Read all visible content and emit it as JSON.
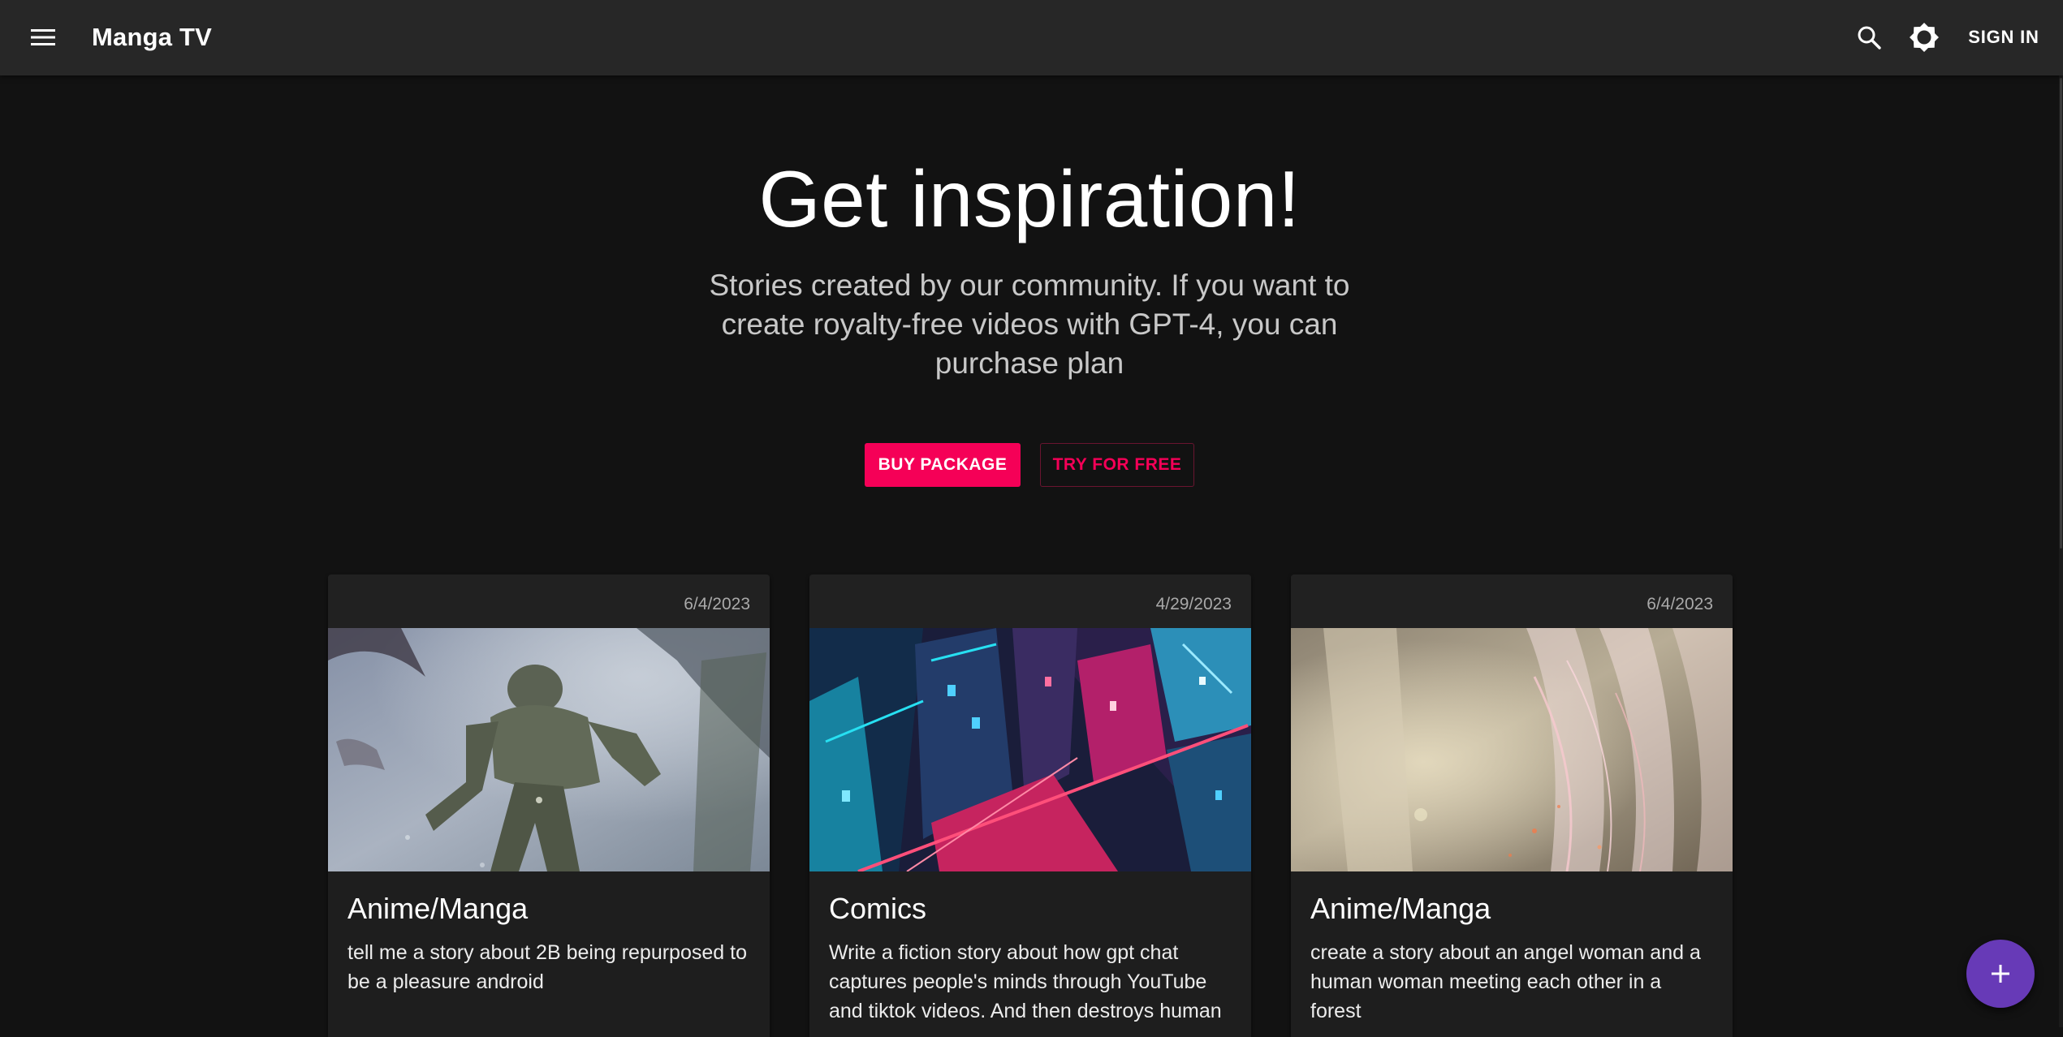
{
  "app": {
    "title": "Manga TV",
    "sign_in_label": "SIGN IN",
    "icons": {
      "menu": "menu-icon",
      "search": "search-icon",
      "theme": "brightness-icon",
      "fab": "add-icon"
    }
  },
  "hero": {
    "title": "Get inspiration!",
    "subtitle": "Stories created by our community. If you want to create royalty-free videos with GPT-4, you can purchase plan",
    "buy_label": "BUY PACKAGE",
    "try_label": "TRY FOR FREE"
  },
  "cards": [
    {
      "date": "6/4/2023",
      "title": "Anime/Manga",
      "text": "tell me a story about 2B being repurposed to be a pleasure android"
    },
    {
      "date": "4/29/2023",
      "title": "Comics",
      "text": "Write a fiction story about how gpt chat captures people's minds through YouTube and tiktok videos. And then destroys human"
    },
    {
      "date": "6/4/2023",
      "title": "Anime/Manga",
      "text": "create a story about an angel woman and a human woman meeting each other in a forest"
    }
  ],
  "colors": {
    "primary": "#f50057",
    "fab": "#673ab7",
    "appbar": "#272727",
    "background": "#121212",
    "card": "#1e1e1e"
  }
}
